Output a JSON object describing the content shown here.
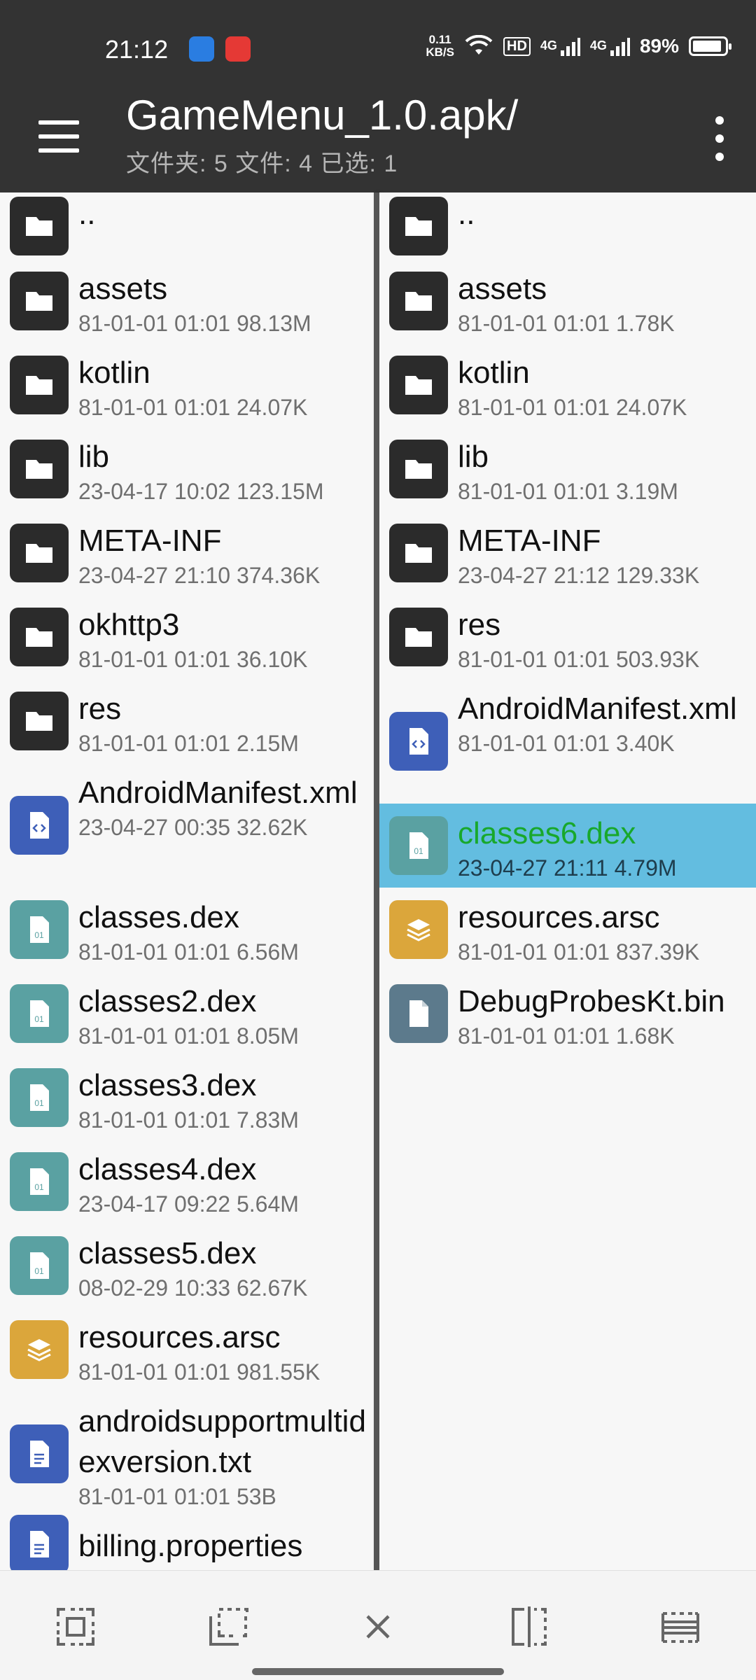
{
  "status": {
    "time": "21:12",
    "speed_value": "0.11",
    "speed_unit": "KB/S",
    "hd": "HD",
    "net1": "4G",
    "net2": "4G",
    "battery": "89%"
  },
  "appbar": {
    "title": "GameMenu_1.0.apk/",
    "subtitle": "文件夹: 5   文件: 4   已选: 1"
  },
  "left_pane": {
    "items": [
      {
        "name": "..",
        "meta": "",
        "type": "folder"
      },
      {
        "name": "assets",
        "meta": "81-01-01 01:01 98.13M",
        "type": "folder"
      },
      {
        "name": "kotlin",
        "meta": "81-01-01 01:01 24.07K",
        "type": "folder"
      },
      {
        "name": "lib",
        "meta": "23-04-17 10:02 123.15M",
        "type": "folder"
      },
      {
        "name": "META-INF",
        "meta": "23-04-27 21:10 374.36K",
        "type": "folder"
      },
      {
        "name": "okhttp3",
        "meta": "81-01-01 01:01 36.10K",
        "type": "folder"
      },
      {
        "name": "res",
        "meta": "81-01-01 01:01 2.15M",
        "type": "folder"
      },
      {
        "name": "AndroidManifest.xml",
        "meta": "23-04-27 00:35 32.62K",
        "type": "xml"
      },
      {
        "name": "classes.dex",
        "meta": "81-01-01 01:01 6.56M",
        "type": "dex"
      },
      {
        "name": "classes2.dex",
        "meta": "81-01-01 01:01 8.05M",
        "type": "dex"
      },
      {
        "name": "classes3.dex",
        "meta": "81-01-01 01:01 7.83M",
        "type": "dex"
      },
      {
        "name": "classes4.dex",
        "meta": "23-04-17 09:22 5.64M",
        "type": "dex"
      },
      {
        "name": "classes5.dex",
        "meta": "08-02-29 10:33 62.67K",
        "type": "dex"
      },
      {
        "name": "resources.arsc",
        "meta": "81-01-01 01:01 981.55K",
        "type": "arsc"
      },
      {
        "name": "androidsupportmultidexversion.txt",
        "meta": "81-01-01 01:01 53B",
        "type": "txt"
      },
      {
        "name": "billing.properties",
        "meta": "",
        "type": "txt"
      }
    ]
  },
  "right_pane": {
    "items": [
      {
        "name": "..",
        "meta": "",
        "type": "folder"
      },
      {
        "name": "assets",
        "meta": "81-01-01 01:01 1.78K",
        "type": "folder"
      },
      {
        "name": "kotlin",
        "meta": "81-01-01 01:01 24.07K",
        "type": "folder"
      },
      {
        "name": "lib",
        "meta": "81-01-01 01:01 3.19M",
        "type": "folder"
      },
      {
        "name": "META-INF",
        "meta": "23-04-27 21:12 129.33K",
        "type": "folder"
      },
      {
        "name": "res",
        "meta": "81-01-01 01:01 503.93K",
        "type": "folder"
      },
      {
        "name": "AndroidManifest.xml",
        "meta": "81-01-01 01:01 3.40K",
        "type": "xml"
      },
      {
        "name": "classes6.dex",
        "meta": "23-04-27 21:11 4.79M",
        "type": "dex",
        "selected": true
      },
      {
        "name": "resources.arsc",
        "meta": "81-01-01 01:01 837.39K",
        "type": "arsc"
      },
      {
        "name": "DebugProbesKt.bin",
        "meta": "81-01-01 01:01 1.68K",
        "type": "bin"
      }
    ]
  },
  "bottombar": {
    "buttons": [
      "select-all-icon",
      "select-range-icon",
      "close-icon",
      "split-view-icon",
      "list-select-icon"
    ]
  },
  "colors": {
    "bar": "#333333",
    "selected_row": "#63bde0",
    "selected_text": "#18a82c"
  }
}
